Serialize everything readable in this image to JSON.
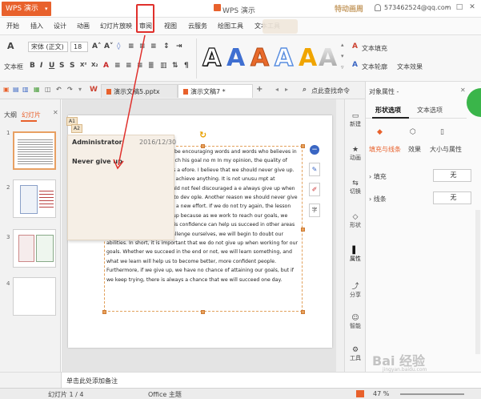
{
  "app": {
    "button_label": "WPS 演示",
    "doc_title": "WPS 演示",
    "user": "573462524@qq.com"
  },
  "menu": [
    "开始",
    "插入",
    "设计",
    "动画",
    "幻灯片放映",
    "审阅",
    "视图",
    "云服务",
    "绘图工具",
    "文本工具"
  ],
  "ribbon": {
    "font_name": "宋体 (正文)",
    "font_size": "18",
    "text_fill": "文本填充",
    "text_outline": "文本轮廓",
    "text_effect": "文本效果",
    "textbox_label": "文本框",
    "art_colors": [
      "#111111",
      "#3f6fd1",
      "#e86a2b",
      "#5b8fe0",
      "#f0a500",
      "#8a8a8a"
    ]
  },
  "tabs": {
    "doc1": "演示文稿5.pptx",
    "doc2": "演示文稿7 *",
    "search": "点此查找命令"
  },
  "left_panel": {
    "tab_outline": "大纲",
    "tab_slides": "幻灯片",
    "slide_numbers": [
      "1",
      "2",
      "3",
      "4"
    ]
  },
  "comment": {
    "author": "Administrator",
    "date": "2016/12/30",
    "text": "Never give up",
    "marker1": "A1",
    "marker2": "A2"
  },
  "slide_text": "never give up. \" These can be encouraging words and words who believes in them will keep trying to reach his goal no m In my opinion, the quality of determination to succeed is a efore. I believe that we should never give up. up too easily, we will rarely achieve anything. It is not unusu mpt at something new, so we should not feel discouraged a e always give up when we fail, we will not be able to dev ople. Another reason we should never give up is that we ca if we make a new effort. If we do not try again, the lesson ally, we should never give up because as we work to reach our goals, we develop confidence, and this confidence can help us succeed in other areas of our lives. If we never challenge ourselves, we will begin to doubt our abilities. In short, it is important that we do not give up when working for our goals. Whether we succeed in the end or not, we will learn something, and what we learn will help us to become better, more confident people. Furthermore, if we give up, we have no chance of attaining our goals, but if we keep trying, there is always a chance that we will succeed one day.",
  "right_bar": [
    "新建",
    "动画",
    "切换",
    "形状",
    "属性",
    "分享",
    "智能",
    "工具"
  ],
  "props": {
    "title": "对象属性 -",
    "tab_shape": "形状选项",
    "tab_text": "文本选项",
    "sub_fill_line": "填充与线条",
    "sub_effect": "效果",
    "sub_size": "大小与属性",
    "fill_label": "填充",
    "fill_value": "无",
    "line_label": "线条",
    "line_value": "无"
  },
  "notes": {
    "placeholder": "单击此处添加备注"
  },
  "status": {
    "slide": "幻灯片 1 / 4",
    "theme": "Office 主题",
    "zoom": "47 %"
  },
  "watermark": {
    "text": "Bai 经验",
    "sub": "jingyan.baidu.com"
  }
}
